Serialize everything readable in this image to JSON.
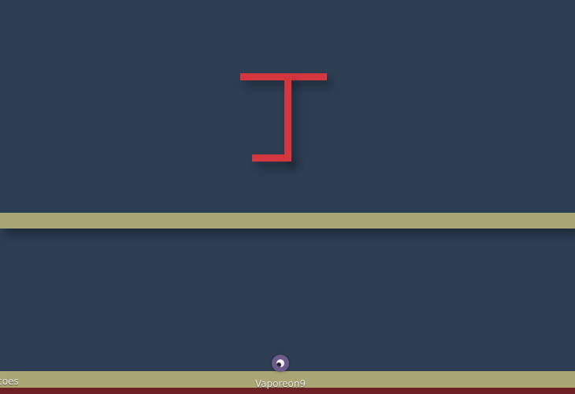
{
  "colors": {
    "background": "#2d3d52",
    "obstacle": "#d4373e",
    "platform": "#aaa673",
    "lava": "#6e1f23",
    "player": "#6b5a87"
  },
  "players": [
    {
      "name": "Vaporeon9",
      "icon": "player-ball-icon"
    },
    {
      "name": "toes"
    }
  ]
}
